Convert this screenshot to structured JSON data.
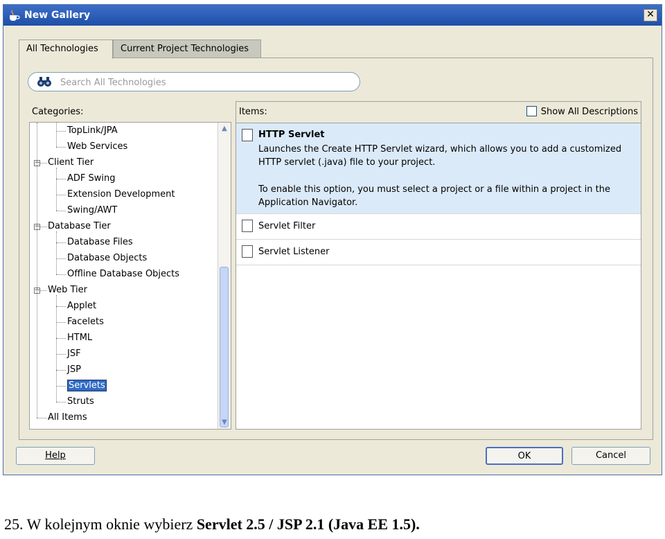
{
  "window": {
    "title": "New Gallery",
    "close": "✕"
  },
  "tabs": {
    "all": "All Technologies",
    "current": "Current Project Technologies"
  },
  "search": {
    "placeholder": "Search All Technologies"
  },
  "categories": {
    "label": "Categories:",
    "items": [
      {
        "label": "TopLink/JPA",
        "level": 2
      },
      {
        "label": "Web Services",
        "level": 2
      },
      {
        "label": "Client Tier",
        "level": 1
      },
      {
        "label": "ADF Swing",
        "level": 2
      },
      {
        "label": "Extension Development",
        "level": 2
      },
      {
        "label": "Swing/AWT",
        "level": 2
      },
      {
        "label": "Database Tier",
        "level": 1
      },
      {
        "label": "Database Files",
        "level": 2
      },
      {
        "label": "Database Objects",
        "level": 2
      },
      {
        "label": "Offline Database Objects",
        "level": 2
      },
      {
        "label": "Web Tier",
        "level": 1
      },
      {
        "label": "Applet",
        "level": 2
      },
      {
        "label": "Facelets",
        "level": 2
      },
      {
        "label": "HTML",
        "level": 2
      },
      {
        "label": "JSF",
        "level": 2
      },
      {
        "label": "JSP",
        "level": 2
      },
      {
        "label": "Servlets",
        "level": 2,
        "selected": true
      },
      {
        "label": "Struts",
        "level": 2
      },
      {
        "label": "All Items",
        "level": 0
      }
    ]
  },
  "items_panel": {
    "label": "Items:",
    "show_descriptions": "Show All Descriptions",
    "items": [
      {
        "title": "HTTP Servlet",
        "desc1": "Launches the Create HTTP Servlet wizard, which allows you to add a customized HTTP servlet (.java) file to your project.",
        "desc2": "To enable this option, you must select a project or a file within a project in the Application Navigator."
      },
      {
        "title": "Servlet Filter"
      },
      {
        "title": "Servlet Listener"
      }
    ]
  },
  "buttons": {
    "help": "Help",
    "ok": "OK",
    "cancel": "Cancel"
  },
  "caption": {
    "prefix": "25. W kolejnym oknie wybierz",
    "bold": "Servlet 2.5 / JSP 2.1 (Java EE 1.5)."
  }
}
